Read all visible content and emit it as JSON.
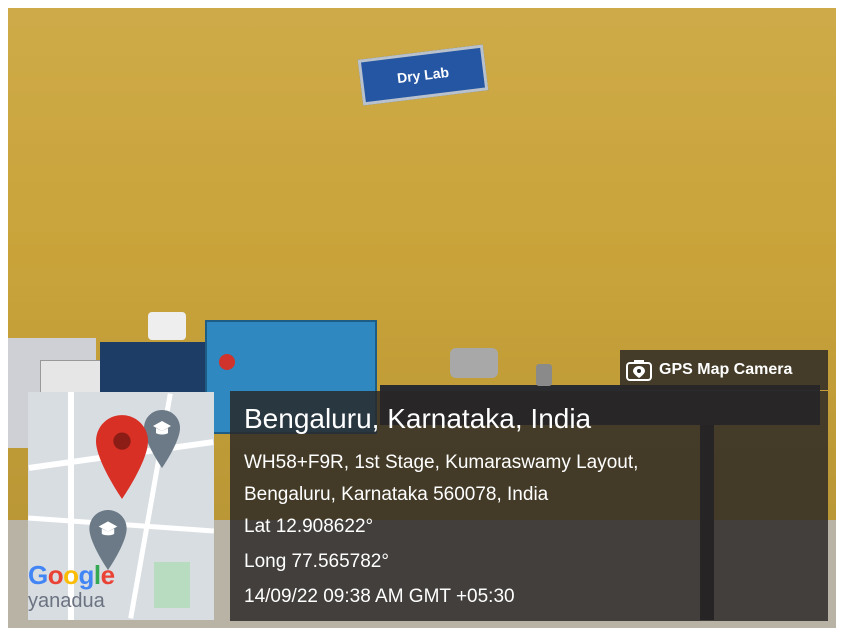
{
  "sign": {
    "text": "Dry Lab"
  },
  "camera_tag": {
    "label": "GPS Map Camera",
    "icon": "gps-camera-icon"
  },
  "location": {
    "title": "Bengaluru, Karnataka, India",
    "address_line_1": "WH58+F9R, 1st Stage, Kumaraswamy Layout,",
    "address_line_2": "Bengaluru, Karnataka 560078, India",
    "lat": "Lat 12.908622°",
    "long": "Long 77.565782°",
    "datetime": "14/09/22 09:38 AM GMT +05:30"
  },
  "map_thumbnail": {
    "logo": "Google",
    "place_text": "yanadua",
    "pin_color": "#d93025"
  },
  "colors": {
    "wall": "#c9a33a",
    "overlay": "#282624",
    "sign_blue": "#2456a3"
  }
}
